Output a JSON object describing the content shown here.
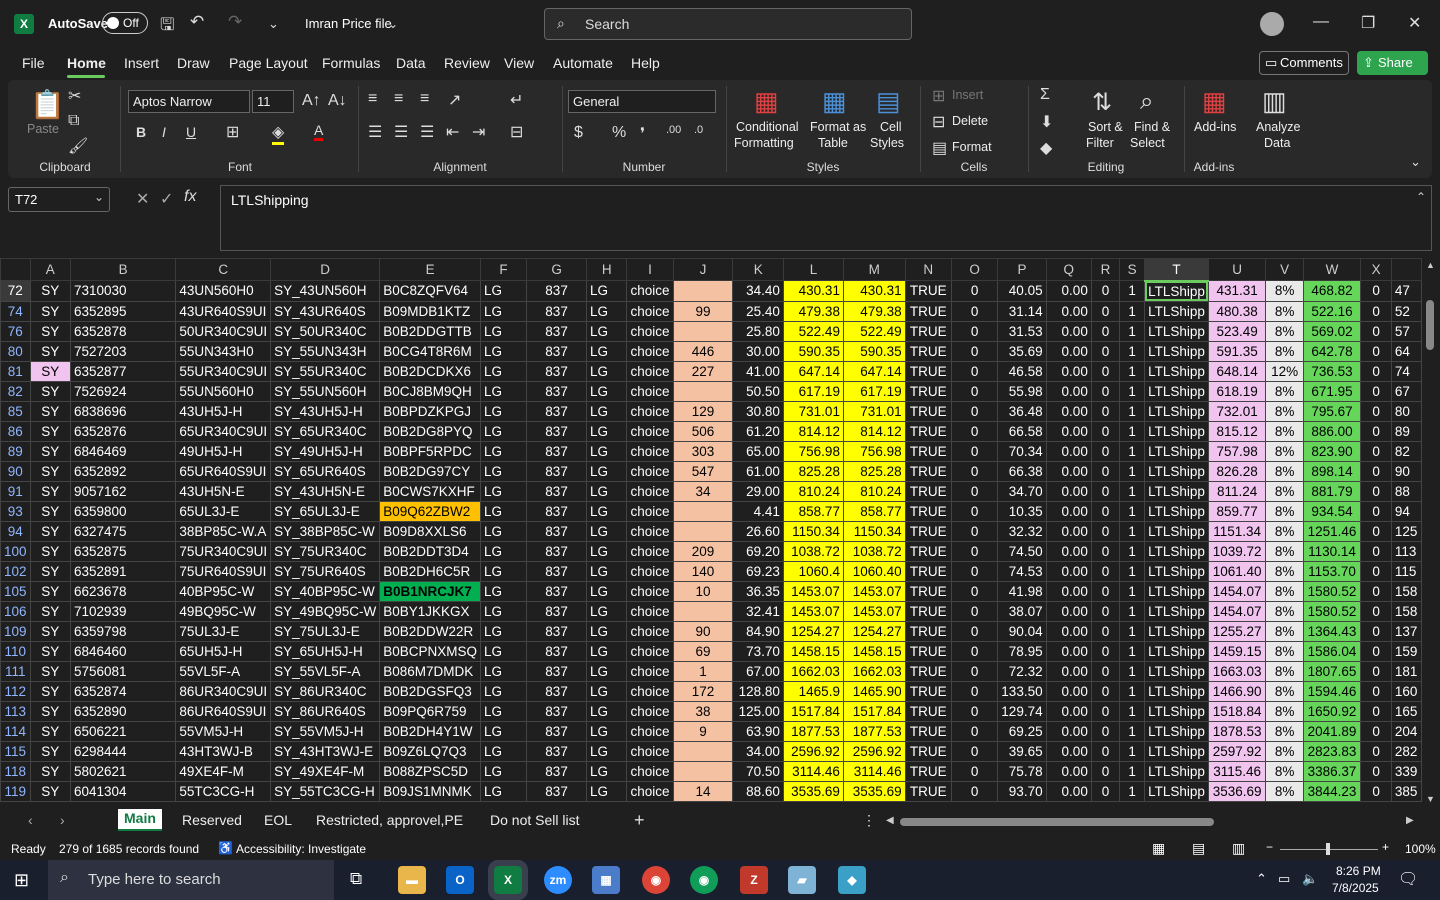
{
  "titlebar": {
    "autosave_label": "AutoSave",
    "autosave_state": "Off",
    "file_name": "Imran Price file",
    "search_placeholder": "Search"
  },
  "menu": [
    "File",
    "Home",
    "Insert",
    "Draw",
    "Page Layout",
    "Formulas",
    "Data",
    "Review",
    "View",
    "Automate",
    "Help"
  ],
  "active_menu": "Home",
  "buttons": {
    "comments": "Comments",
    "share": "Share"
  },
  "ribbon": {
    "clipboard": {
      "label": "Clipboard",
      "paste": "Paste"
    },
    "font": {
      "label": "Font",
      "name": "Aptos Narrow",
      "size": "11"
    },
    "alignment": {
      "label": "Alignment"
    },
    "number": {
      "label": "Number",
      "format": "General"
    },
    "styles": {
      "label": "Styles",
      "conditional": "Conditional",
      "conditional2": "Formatting",
      "format_table": "Format as",
      "format_table2": "Table",
      "cell_styles": "Cell",
      "cell_styles2": "Styles"
    },
    "cells": {
      "label": "Cells",
      "insert": "Insert",
      "delete": "Delete",
      "format": "Format"
    },
    "editing": {
      "label": "Editing",
      "sort": "Sort &",
      "sort2": "Filter",
      "find": "Find &",
      "find2": "Select"
    },
    "addins": {
      "label": "Add-ins",
      "addins": "Add-ins",
      "analyze": "Analyze",
      "analyze2": "Data"
    }
  },
  "formula_bar": {
    "name_box": "T72",
    "content": "LTLShipping"
  },
  "columns": [
    "A",
    "B",
    "C",
    "D",
    "E",
    "F",
    "G",
    "H",
    "I",
    "J",
    "K",
    "L",
    "M",
    "N",
    "O",
    "P",
    "Q",
    "R",
    "S",
    "T",
    "U",
    "V",
    "W",
    "X",
    ""
  ],
  "rows": [
    {
      "n": "72",
      "A": "SY",
      "B": "7310030",
      "C": "43UN560H0",
      "D": "SY_43UN560H",
      "E": "B0C8ZQFV64",
      "F": "LG",
      "G": "837",
      "H": "LG",
      "I": "choice",
      "J": "",
      "K": "34.40",
      "L": "430.31",
      "M": "430.31",
      "N": "TRUE",
      "O": "0",
      "P": "40.05",
      "Q": "0.00",
      "R": "0",
      "S": "1",
      "T": "LTLShipp",
      "U": "431.31",
      "V": "8%",
      "W": "468.82",
      "X": "0",
      "Y": "47"
    },
    {
      "n": "74",
      "A": "SY",
      "B": "6352895",
      "C": "43UR640S9UI",
      "D": "SY_43UR640S",
      "E": "B09MDB1KTZ",
      "F": "LG",
      "G": "837",
      "H": "LG",
      "I": "choice",
      "J": "99",
      "K": "25.40",
      "L": "479.38",
      "M": "479.38",
      "N": "TRUE",
      "O": "0",
      "P": "31.14",
      "Q": "0.00",
      "R": "0",
      "S": "1",
      "T": "LTLShipp",
      "U": "480.38",
      "V": "8%",
      "W": "522.16",
      "X": "0",
      "Y": "52"
    },
    {
      "n": "76",
      "A": "SY",
      "B": "6352878",
      "C": "50UR340C9UI",
      "D": "SY_50UR340C",
      "E": "B0B2DDGTTB",
      "F": "LG",
      "G": "837",
      "H": "LG",
      "I": "choice",
      "J": "",
      "K": "25.80",
      "L": "522.49",
      "M": "522.49",
      "N": "TRUE",
      "O": "0",
      "P": "31.53",
      "Q": "0.00",
      "R": "0",
      "S": "1",
      "T": "LTLShipp",
      "U": "523.49",
      "V": "8%",
      "W": "569.02",
      "X": "0",
      "Y": "57"
    },
    {
      "n": "80",
      "A": "SY",
      "B": "7527203",
      "C": "55UN343H0",
      "D": "SY_55UN343H",
      "E": "B0CG4T8R6M",
      "F": "LG",
      "G": "837",
      "H": "LG",
      "I": "choice",
      "J": "446",
      "K": "30.00",
      "L": "590.35",
      "M": "590.35",
      "N": "TRUE",
      "O": "0",
      "P": "35.69",
      "Q": "0.00",
      "R": "0",
      "S": "1",
      "T": "LTLShipp",
      "U": "591.35",
      "V": "8%",
      "W": "642.78",
      "X": "0",
      "Y": "64"
    },
    {
      "n": "81",
      "A": "SY",
      "B": "6352877",
      "C": "55UR340C9UI",
      "D": "SY_55UR340C",
      "E": "B0B2DCDKX6",
      "F": "LG",
      "G": "837",
      "H": "LG",
      "I": "choice",
      "J": "227",
      "K": "41.00",
      "L": "647.14",
      "M": "647.14",
      "N": "TRUE",
      "O": "0",
      "P": "46.58",
      "Q": "0.00",
      "R": "0",
      "S": "1",
      "T": "LTLShipp",
      "U": "648.14",
      "V": "12%",
      "W": "736.53",
      "X": "0",
      "Y": "74"
    },
    {
      "n": "82",
      "A": "SY",
      "B": "7526924",
      "C": "55UN560H0",
      "D": "SY_55UN560H",
      "E": "B0CJ8BM9QH",
      "F": "LG",
      "G": "837",
      "H": "LG",
      "I": "choice",
      "J": "",
      "K": "50.50",
      "L": "617.19",
      "M": "617.19",
      "N": "TRUE",
      "O": "0",
      "P": "55.98",
      "Q": "0.00",
      "R": "0",
      "S": "1",
      "T": "LTLShipp",
      "U": "618.19",
      "V": "8%",
      "W": "671.95",
      "X": "0",
      "Y": "67"
    },
    {
      "n": "85",
      "A": "SY",
      "B": "6838696",
      "C": "43UH5J-H",
      "D": "SY_43UH5J-H",
      "E": "B0BPDZKPGJ",
      "F": "LG",
      "G": "837",
      "H": "LG",
      "I": "choice",
      "J": "129",
      "K": "30.80",
      "L": "731.01",
      "M": "731.01",
      "N": "TRUE",
      "O": "0",
      "P": "36.48",
      "Q": "0.00",
      "R": "0",
      "S": "1",
      "T": "LTLShipp",
      "U": "732.01",
      "V": "8%",
      "W": "795.67",
      "X": "0",
      "Y": "80"
    },
    {
      "n": "86",
      "A": "SY",
      "B": "6352876",
      "C": "65UR340C9UI",
      "D": "SY_65UR340C",
      "E": "B0B2DG8PYQ",
      "F": "LG",
      "G": "837",
      "H": "LG",
      "I": "choice",
      "J": "506",
      "K": "61.20",
      "L": "814.12",
      "M": "814.12",
      "N": "TRUE",
      "O": "0",
      "P": "66.58",
      "Q": "0.00",
      "R": "0",
      "S": "1",
      "T": "LTLShipp",
      "U": "815.12",
      "V": "8%",
      "W": "886.00",
      "X": "0",
      "Y": "89"
    },
    {
      "n": "89",
      "A": "SY",
      "B": "6846469",
      "C": "49UH5J-H",
      "D": "SY_49UH5J-H",
      "E": "B0BPF5RPDC",
      "F": "LG",
      "G": "837",
      "H": "LG",
      "I": "choice",
      "J": "303",
      "K": "65.00",
      "L": "756.98",
      "M": "756.98",
      "N": "TRUE",
      "O": "0",
      "P": "70.34",
      "Q": "0.00",
      "R": "0",
      "S": "1",
      "T": "LTLShipp",
      "U": "757.98",
      "V": "8%",
      "W": "823.90",
      "X": "0",
      "Y": "82"
    },
    {
      "n": "90",
      "A": "SY",
      "B": "6352892",
      "C": "65UR640S9UI",
      "D": "SY_65UR640S",
      "E": "B0B2DG97CY",
      "F": "LG",
      "G": "837",
      "H": "LG",
      "I": "choice",
      "J": "547",
      "K": "61.00",
      "L": "825.28",
      "M": "825.28",
      "N": "TRUE",
      "O": "0",
      "P": "66.38",
      "Q": "0.00",
      "R": "0",
      "S": "1",
      "T": "LTLShipp",
      "U": "826.28",
      "V": "8%",
      "W": "898.14",
      "X": "0",
      "Y": "90"
    },
    {
      "n": "91",
      "A": "SY",
      "B": "9057162",
      "C": "43UH5N-E",
      "D": "SY_43UH5N-E",
      "E": "B0CWS7KXHF",
      "F": "LG",
      "G": "837",
      "H": "LG",
      "I": "choice",
      "J": "34",
      "K": "29.00",
      "L": "810.24",
      "M": "810.24",
      "N": "TRUE",
      "O": "0",
      "P": "34.70",
      "Q": "0.00",
      "R": "0",
      "S": "1",
      "T": "LTLShipp",
      "U": "811.24",
      "V": "8%",
      "W": "881.79",
      "X": "0",
      "Y": "88"
    },
    {
      "n": "93",
      "A": "SY",
      "B": "6359800",
      "C": "65UL3J-E",
      "D": "SY_65UL3J-E",
      "E": "B09Q62ZBW2",
      "F": "LG",
      "G": "837",
      "H": "LG",
      "I": "choice",
      "J": "",
      "K": "4.41",
      "L": "858.77",
      "M": "858.77",
      "N": "TRUE",
      "O": "0",
      "P": "10.35",
      "Q": "0.00",
      "R": "0",
      "S": "1",
      "T": "LTLShipp",
      "U": "859.77",
      "V": "8%",
      "W": "934.54",
      "X": "0",
      "Y": "94"
    },
    {
      "n": "94",
      "A": "SY",
      "B": "6327475",
      "C": "38BP85C-W.A",
      "D": "SY_38BP85C-W",
      "E": "B09D8XXLS6",
      "F": "LG",
      "G": "837",
      "H": "LG",
      "I": "choice",
      "J": "",
      "K": "26.60",
      "L": "1150.34",
      "M": "1150.34",
      "N": "TRUE",
      "O": "0",
      "P": "32.32",
      "Q": "0.00",
      "R": "0",
      "S": "1",
      "T": "LTLShipp",
      "U": "1151.34",
      "V": "8%",
      "W": "1251.46",
      "X": "0",
      "Y": "125"
    },
    {
      "n": "100",
      "A": "SY",
      "B": "6352875",
      "C": "75UR340C9UI",
      "D": "SY_75UR340C",
      "E": "B0B2DDT3D4",
      "F": "LG",
      "G": "837",
      "H": "LG",
      "I": "choice",
      "J": "209",
      "K": "69.20",
      "L": "1038.72",
      "M": "1038.72",
      "N": "TRUE",
      "O": "0",
      "P": "74.50",
      "Q": "0.00",
      "R": "0",
      "S": "1",
      "T": "LTLShipp",
      "U": "1039.72",
      "V": "8%",
      "W": "1130.14",
      "X": "0",
      "Y": "113"
    },
    {
      "n": "102",
      "A": "SY",
      "B": "6352891",
      "C": "75UR640S9UI",
      "D": "SY_75UR640S",
      "E": "B0B2DH6C5R",
      "F": "LG",
      "G": "837",
      "H": "LG",
      "I": "choice",
      "J": "140",
      "K": "69.23",
      "L": "1060.4",
      "M": "1060.40",
      "N": "TRUE",
      "O": "0",
      "P": "74.53",
      "Q": "0.00",
      "R": "0",
      "S": "1",
      "T": "LTLShipp",
      "U": "1061.40",
      "V": "8%",
      "W": "1153.70",
      "X": "0",
      "Y": "115"
    },
    {
      "n": "105",
      "A": "SY",
      "B": "6623678",
      "C": "40BP95C-W",
      "D": "SY_40BP95C-W",
      "E": "B0B1NRCJK7",
      "F": "LG",
      "G": "837",
      "H": "LG",
      "I": "choice",
      "J": "10",
      "K": "36.35",
      "L": "1453.07",
      "M": "1453.07",
      "N": "TRUE",
      "O": "0",
      "P": "41.98",
      "Q": "0.00",
      "R": "0",
      "S": "1",
      "T": "LTLShipp",
      "U": "1454.07",
      "V": "8%",
      "W": "1580.52",
      "X": "0",
      "Y": "158"
    },
    {
      "n": "106",
      "A": "SY",
      "B": "7102939",
      "C": "49BQ95C-W",
      "D": "SY_49BQ95C-W",
      "E": "B0BY1JKKGX",
      "F": "LG",
      "G": "837",
      "H": "LG",
      "I": "choice",
      "J": "",
      "K": "32.41",
      "L": "1453.07",
      "M": "1453.07",
      "N": "TRUE",
      "O": "0",
      "P": "38.07",
      "Q": "0.00",
      "R": "0",
      "S": "1",
      "T": "LTLShipp",
      "U": "1454.07",
      "V": "8%",
      "W": "1580.52",
      "X": "0",
      "Y": "158"
    },
    {
      "n": "109",
      "A": "SY",
      "B": "6359798",
      "C": "75UL3J-E",
      "D": "SY_75UL3J-E",
      "E": "B0B2DDW22R",
      "F": "LG",
      "G": "837",
      "H": "LG",
      "I": "choice",
      "J": "90",
      "K": "84.90",
      "L": "1254.27",
      "M": "1254.27",
      "N": "TRUE",
      "O": "0",
      "P": "90.04",
      "Q": "0.00",
      "R": "0",
      "S": "1",
      "T": "LTLShipp",
      "U": "1255.27",
      "V": "8%",
      "W": "1364.43",
      "X": "0",
      "Y": "137"
    },
    {
      "n": "110",
      "A": "SY",
      "B": "6846460",
      "C": "65UH5J-H",
      "D": "SY_65UH5J-H",
      "E": "B0BCPNXMSQ",
      "F": "LG",
      "G": "837",
      "H": "LG",
      "I": "choice",
      "J": "69",
      "K": "73.70",
      "L": "1458.15",
      "M": "1458.15",
      "N": "TRUE",
      "O": "0",
      "P": "78.95",
      "Q": "0.00",
      "R": "0",
      "S": "1",
      "T": "LTLShipp",
      "U": "1459.15",
      "V": "8%",
      "W": "1586.04",
      "X": "0",
      "Y": "159"
    },
    {
      "n": "111",
      "A": "SY",
      "B": "5756081",
      "C": "55VL5F-A",
      "D": "SY_55VL5F-A",
      "E": "B086M7DMDK",
      "F": "LG",
      "G": "837",
      "H": "LG",
      "I": "choice",
      "J": "1",
      "K": "67.00",
      "L": "1662.03",
      "M": "1662.03",
      "N": "TRUE",
      "O": "0",
      "P": "72.32",
      "Q": "0.00",
      "R": "0",
      "S": "1",
      "T": "LTLShipp",
      "U": "1663.03",
      "V": "8%",
      "W": "1807.65",
      "X": "0",
      "Y": "181"
    },
    {
      "n": "112",
      "A": "SY",
      "B": "6352874",
      "C": "86UR340C9UI",
      "D": "SY_86UR340C",
      "E": "B0B2DGSFQ3",
      "F": "LG",
      "G": "837",
      "H": "LG",
      "I": "choice",
      "J": "172",
      "K": "128.80",
      "L": "1465.9",
      "M": "1465.90",
      "N": "TRUE",
      "O": "0",
      "P": "133.50",
      "Q": "0.00",
      "R": "0",
      "S": "1",
      "T": "LTLShipp",
      "U": "1466.90",
      "V": "8%",
      "W": "1594.46",
      "X": "0",
      "Y": "160"
    },
    {
      "n": "113",
      "A": "SY",
      "B": "6352890",
      "C": "86UR640S9UI",
      "D": "SY_86UR640S",
      "E": "B09PQ6R759",
      "F": "LG",
      "G": "837",
      "H": "LG",
      "I": "choice",
      "J": "38",
      "K": "125.00",
      "L": "1517.84",
      "M": "1517.84",
      "N": "TRUE",
      "O": "0",
      "P": "129.74",
      "Q": "0.00",
      "R": "0",
      "S": "1",
      "T": "LTLShipp",
      "U": "1518.84",
      "V": "8%",
      "W": "1650.92",
      "X": "0",
      "Y": "165"
    },
    {
      "n": "114",
      "A": "SY",
      "B": "6506221",
      "C": "55VM5J-H",
      "D": "SY_55VM5J-H",
      "E": "B0B2DH4Y1W",
      "F": "LG",
      "G": "837",
      "H": "LG",
      "I": "choice",
      "J": "9",
      "K": "63.90",
      "L": "1877.53",
      "M": "1877.53",
      "N": "TRUE",
      "O": "0",
      "P": "69.25",
      "Q": "0.00",
      "R": "0",
      "S": "1",
      "T": "LTLShipp",
      "U": "1878.53",
      "V": "8%",
      "W": "2041.89",
      "X": "0",
      "Y": "204"
    },
    {
      "n": "115",
      "A": "SY",
      "B": "6298444",
      "C": "43HT3WJ-B",
      "D": "SY_43HT3WJ-E",
      "E": "B09Z6LQ7Q3",
      "F": "LG",
      "G": "837",
      "H": "LG",
      "I": "choice",
      "J": "",
      "K": "34.00",
      "L": "2596.92",
      "M": "2596.92",
      "N": "TRUE",
      "O": "0",
      "P": "39.65",
      "Q": "0.00",
      "R": "0",
      "S": "1",
      "T": "LTLShipp",
      "U": "2597.92",
      "V": "8%",
      "W": "2823.83",
      "X": "0",
      "Y": "282"
    },
    {
      "n": "118",
      "A": "SY",
      "B": "5802621",
      "C": "49XE4F-M",
      "D": "SY_49XE4F-M",
      "E": "B088ZPSC5D",
      "F": "LG",
      "G": "837",
      "H": "LG",
      "I": "choice",
      "J": "",
      "K": "70.50",
      "L": "3114.46",
      "M": "3114.46",
      "N": "TRUE",
      "O": "0",
      "P": "75.78",
      "Q": "0.00",
      "R": "0",
      "S": "1",
      "T": "LTLShipp",
      "U": "3115.46",
      "V": "8%",
      "W": "3386.37",
      "X": "0",
      "Y": "339"
    },
    {
      "n": "119",
      "A": "SY",
      "B": "6041304",
      "C": "55TC3CG-H",
      "D": "SY_55TC3CG-H",
      "E": "B09JS1MNMK",
      "F": "LG",
      "G": "837",
      "H": "LG",
      "I": "choice",
      "J": "14",
      "K": "88.60",
      "L": "3535.69",
      "M": "3535.69",
      "N": "TRUE",
      "O": "0",
      "P": "93.70",
      "Q": "0.00",
      "R": "0",
      "S": "1",
      "T": "LTLShipp",
      "U": "3536.69",
      "V": "8%",
      "W": "3844.23",
      "X": "0",
      "Y": "385"
    }
  ],
  "sheet_tabs": [
    "Main",
    "Reserved",
    "EOL",
    "Restricted, approvel,PE",
    "Do not Sell list"
  ],
  "active_tab": "Main",
  "status": {
    "ready": "Ready",
    "records": "279 of 1685 records found",
    "accessibility": "Accessibility: Investigate",
    "zoom": "100%"
  },
  "taskbar": {
    "search_placeholder": "Type here to search",
    "time": "8:26 PM",
    "date": "7/8/2025"
  },
  "colors": {
    "accent": "#6ccb5f",
    "excel_green": "#107c41",
    "price_yellow": "#ffff00",
    "peach": "#f4c2a3",
    "pink": "#f1c4f0",
    "green": "#65d65a"
  }
}
